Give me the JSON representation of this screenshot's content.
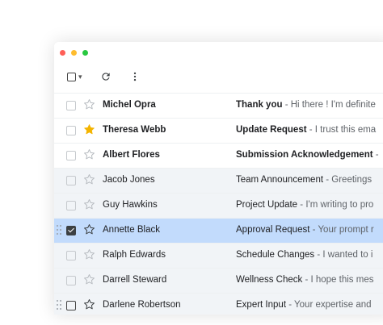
{
  "window": {
    "controls": [
      "close",
      "minimize",
      "maximize"
    ]
  },
  "toolbar": {
    "select_all_icon": "checkbox-icon",
    "caret_icon": "chevron-down-icon",
    "refresh_icon": "refresh-icon",
    "more_icon": "more-vert-icon"
  },
  "colors": {
    "selected_row": "#c2dbfc",
    "read_row": "#f1f4f7",
    "star_active": "#f4b400"
  },
  "emails": [
    {
      "sender": "Michel Opra",
      "subject": "Thank you",
      "sep": " - ",
      "preview": "Hi there ! I'm definite",
      "unread": true,
      "starred": false,
      "checked": false
    },
    {
      "sender": "Theresa Webb",
      "subject": "Update Request",
      "sep": " - ",
      "preview": "I trust this ema",
      "unread": true,
      "starred": true,
      "checked": false
    },
    {
      "sender": "Albert Flores",
      "subject": "Submission Acknowledgement",
      "sep": " -",
      "preview": "",
      "unread": true,
      "starred": false,
      "checked": false
    },
    {
      "sender": "Jacob Jones",
      "subject": "Team Announcement",
      "sep": " - ",
      "preview": "Greetings",
      "unread": false,
      "starred": false,
      "checked": false
    },
    {
      "sender": "Guy Hawkins",
      "subject": "Project Update",
      "sep": " - ",
      "preview": "I'm writing to pro",
      "unread": false,
      "starred": false,
      "checked": false
    },
    {
      "sender": "Annette Black",
      "subject": "Approval Request",
      "sep": " - ",
      "preview": "Your prompt r",
      "unread": false,
      "starred": false,
      "checked": true
    },
    {
      "sender": "Ralph Edwards",
      "subject": "Schedule Changes",
      "sep": " - ",
      "preview": "I wanted to i",
      "unread": false,
      "starred": false,
      "checked": false
    },
    {
      "sender": "Darrell Steward",
      "subject": "Wellness Check",
      "sep": " - ",
      "preview": "I hope this mes",
      "unread": false,
      "starred": false,
      "checked": false
    },
    {
      "sender": "Darlene Robertson",
      "subject": "Expert Input",
      "sep": " - ",
      "preview": "Your expertise and",
      "unread": false,
      "starred": false,
      "checked": false
    }
  ]
}
